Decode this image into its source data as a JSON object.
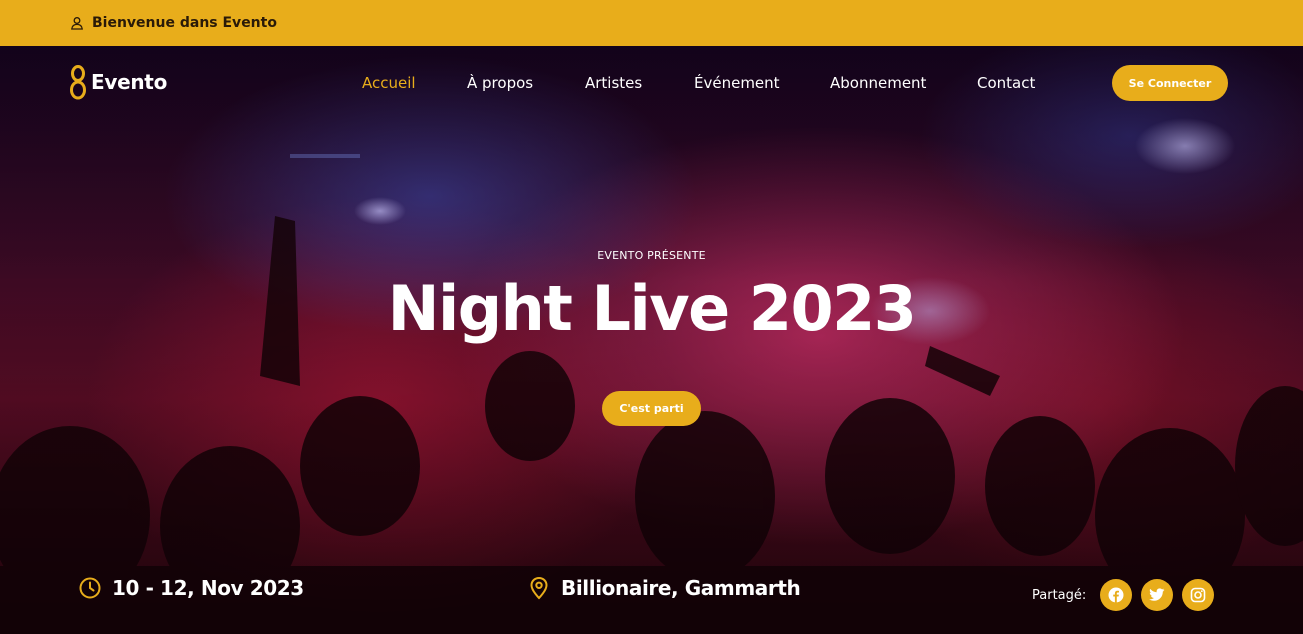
{
  "topbar": {
    "welcome": "Bienvenue dans Evento",
    "icon": "user-icon"
  },
  "brand": {
    "name": "Evento",
    "accent": "#e8ad1b"
  },
  "nav": {
    "items": [
      {
        "label": "Accueil",
        "active": true
      },
      {
        "label": "À propos",
        "active": false
      },
      {
        "label": "Artistes",
        "active": false
      },
      {
        "label": "Événement",
        "active": false
      },
      {
        "label": "Abonnement",
        "active": false
      },
      {
        "label": "Contact",
        "active": false
      }
    ],
    "connect_label": "Se Connecter"
  },
  "hero": {
    "eyebrow": "EVENTO PRÉSENTE",
    "title": "Night Live 2023",
    "cta_label": "C'est parti"
  },
  "info": {
    "date": "10 - 12, Nov 2023",
    "date_icon": "clock-icon",
    "location": "Billionaire, Gammarth",
    "location_icon": "map-pin-icon"
  },
  "share": {
    "label": "Partagé:",
    "networks": [
      "facebook-icon",
      "twitter-icon",
      "instagram-icon"
    ]
  }
}
